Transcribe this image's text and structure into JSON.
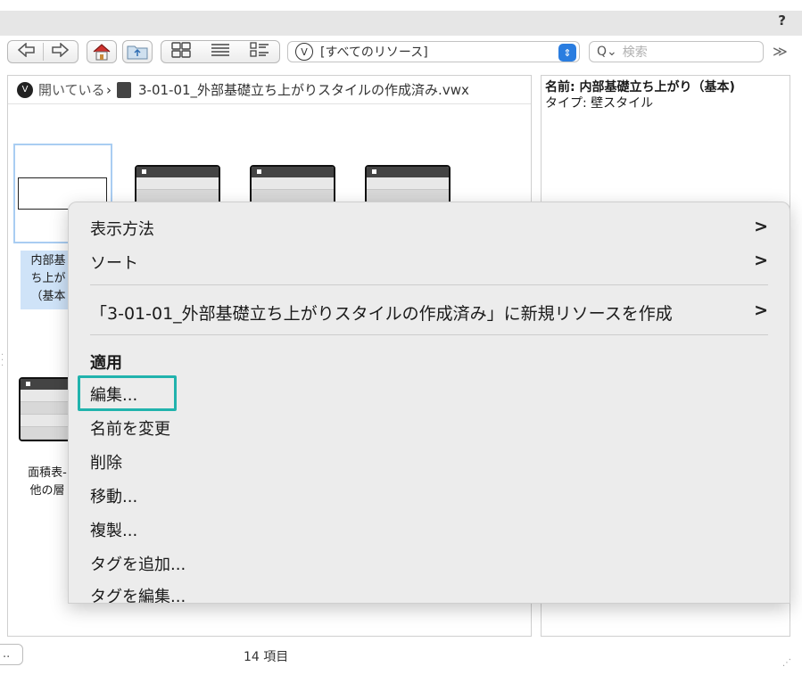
{
  "window": {
    "help_label": "?"
  },
  "toolbar": {
    "back_icon": "back-arrow",
    "forward_icon": "forward-arrow",
    "home_icon": "home",
    "folder_icon": "folder-up",
    "grid_view_icon": "grid-view",
    "list_view_icon": "list-view",
    "detail_view_icon": "detail-view",
    "resource_selector_value": "[すべてのリソース]",
    "resource_selector_icon_text": "V",
    "search_placeholder": "検索",
    "search_icon": "Q⌄",
    "more_label": "≫"
  },
  "path_bar": {
    "root_label": "開いている",
    "separator": "›",
    "file_name": "3-01-01_外部基礎立ち上がりスタイルの作成済み.vwx"
  },
  "info_panel": {
    "name_line": "名前: 内部基礎立ち上がり（基本)",
    "type_line": "タイプ: 壁スタイル"
  },
  "thumbnails": {
    "selected_label_lines": [
      "内部基",
      "ち上が",
      "（基本"
    ],
    "bottom_label_lines": [
      "面積表-",
      "他の層"
    ]
  },
  "status_bar": {
    "left_text": "..",
    "count_text": "14 項目"
  },
  "context_menu": {
    "view_label": "表示方法",
    "sort_label": "ソート",
    "new_resource_label": "「3-01-01_外部基礎立ち上がりスタイルの作成済み」に新規リソースを作成",
    "apply_label": "適用",
    "edit_label": "編集...",
    "rename_label": "名前を変更",
    "delete_label": "削除",
    "move_label": "移動...",
    "duplicate_label": "複製...",
    "add_tag_label": "タグを追加...",
    "edit_tag_label": "タグを編集...",
    "submenu_chevron": ">",
    "highlight_color": "#21b3ad"
  }
}
